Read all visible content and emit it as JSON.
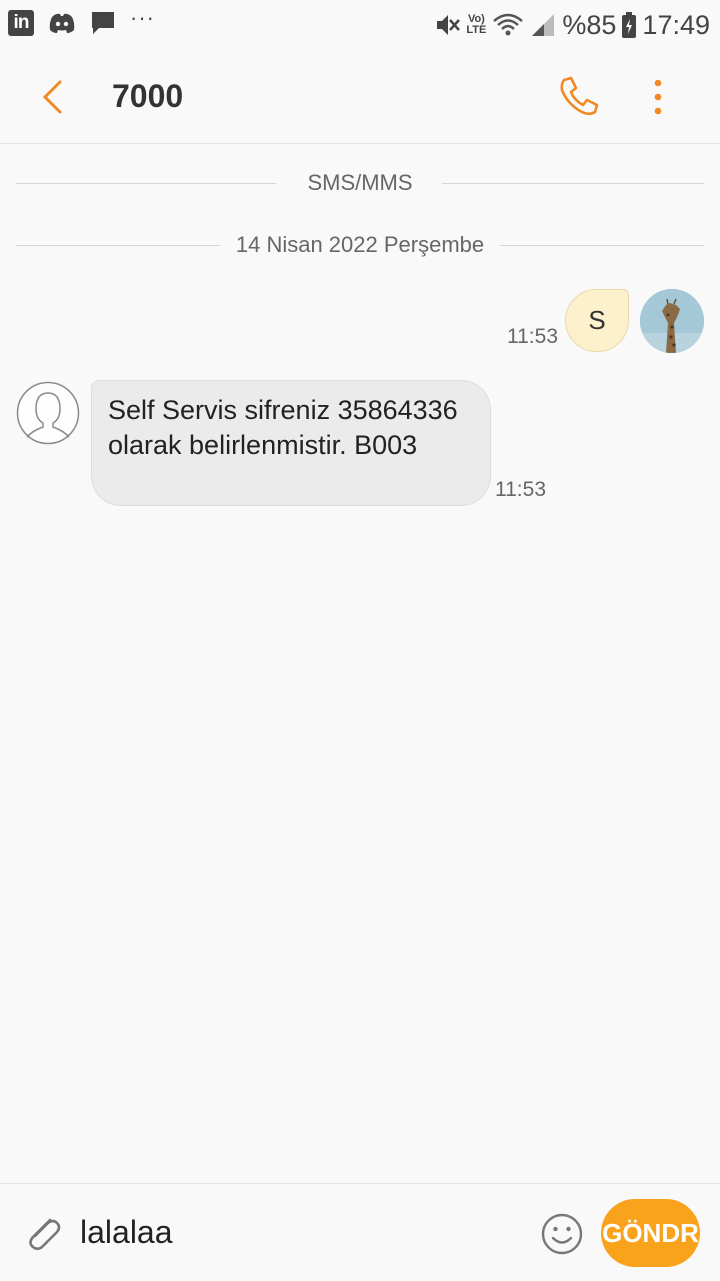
{
  "status_bar": {
    "battery_percent": "%85",
    "time": "17:49",
    "network": "LTE",
    "network_top": "Vo)",
    "more_notifications": "···"
  },
  "header": {
    "title": "7000"
  },
  "dividers": {
    "channel": "SMS/MMS",
    "date": "14 Nisan 2022 Perşembe"
  },
  "messages": [
    {
      "direction": "sent",
      "text": "S",
      "time": "11:53"
    },
    {
      "direction": "received",
      "text": "Self Servis sifreniz 35864336 olarak belirlenmistir. B003",
      "time": "11:53"
    }
  ],
  "composer": {
    "input_value": "lalalaa",
    "send_label": "GÖNDR"
  },
  "colors": {
    "accent": "#f08a24",
    "send_button": "#f9a21b",
    "sent_bubble": "#fdf0cc",
    "received_bubble": "#ebebeb"
  }
}
